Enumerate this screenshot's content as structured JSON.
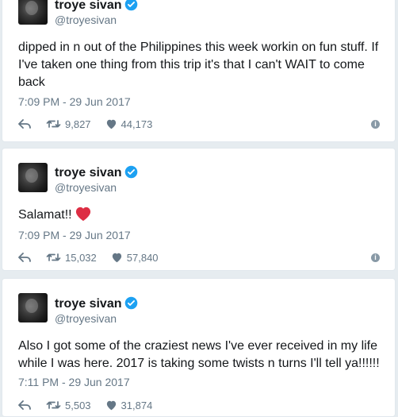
{
  "tweets": [
    {
      "display_name": "troye sivan",
      "handle": "@troyesivan",
      "text": "dipped in n out of the Philippines this week workin on fun stuff. If I've taken one thing from this trip it's that I can't WAIT to come back",
      "timestamp": "7:09 PM - 29 Jun 2017",
      "retweets": "9,827",
      "likes": "44,173"
    },
    {
      "display_name": "troye sivan",
      "handle": "@troyesivan",
      "text": "Salamat!!",
      "timestamp": "7:09 PM - 29 Jun 2017",
      "retweets": "15,032",
      "likes": "57,840"
    },
    {
      "display_name": "troye sivan",
      "handle": "@troyesivan",
      "text": "Also I got some of the craziest news I've ever received in my life while I was here. 2017 is taking some twists n turns I'll tell ya!!!!!!",
      "timestamp": "7:11 PM - 29 Jun 2017",
      "retweets": "5,503",
      "likes": "31,874"
    }
  ],
  "icons": {
    "verified": "verified-badge-icon",
    "reply": "reply-icon",
    "retweet": "retweet-icon",
    "like": "heart-icon",
    "info": "info-icon",
    "emoji": "red-heart-emoji"
  },
  "colors": {
    "verified": "#1da1f2",
    "action_gray": "#657786",
    "emoji_red": "#e0245e"
  }
}
